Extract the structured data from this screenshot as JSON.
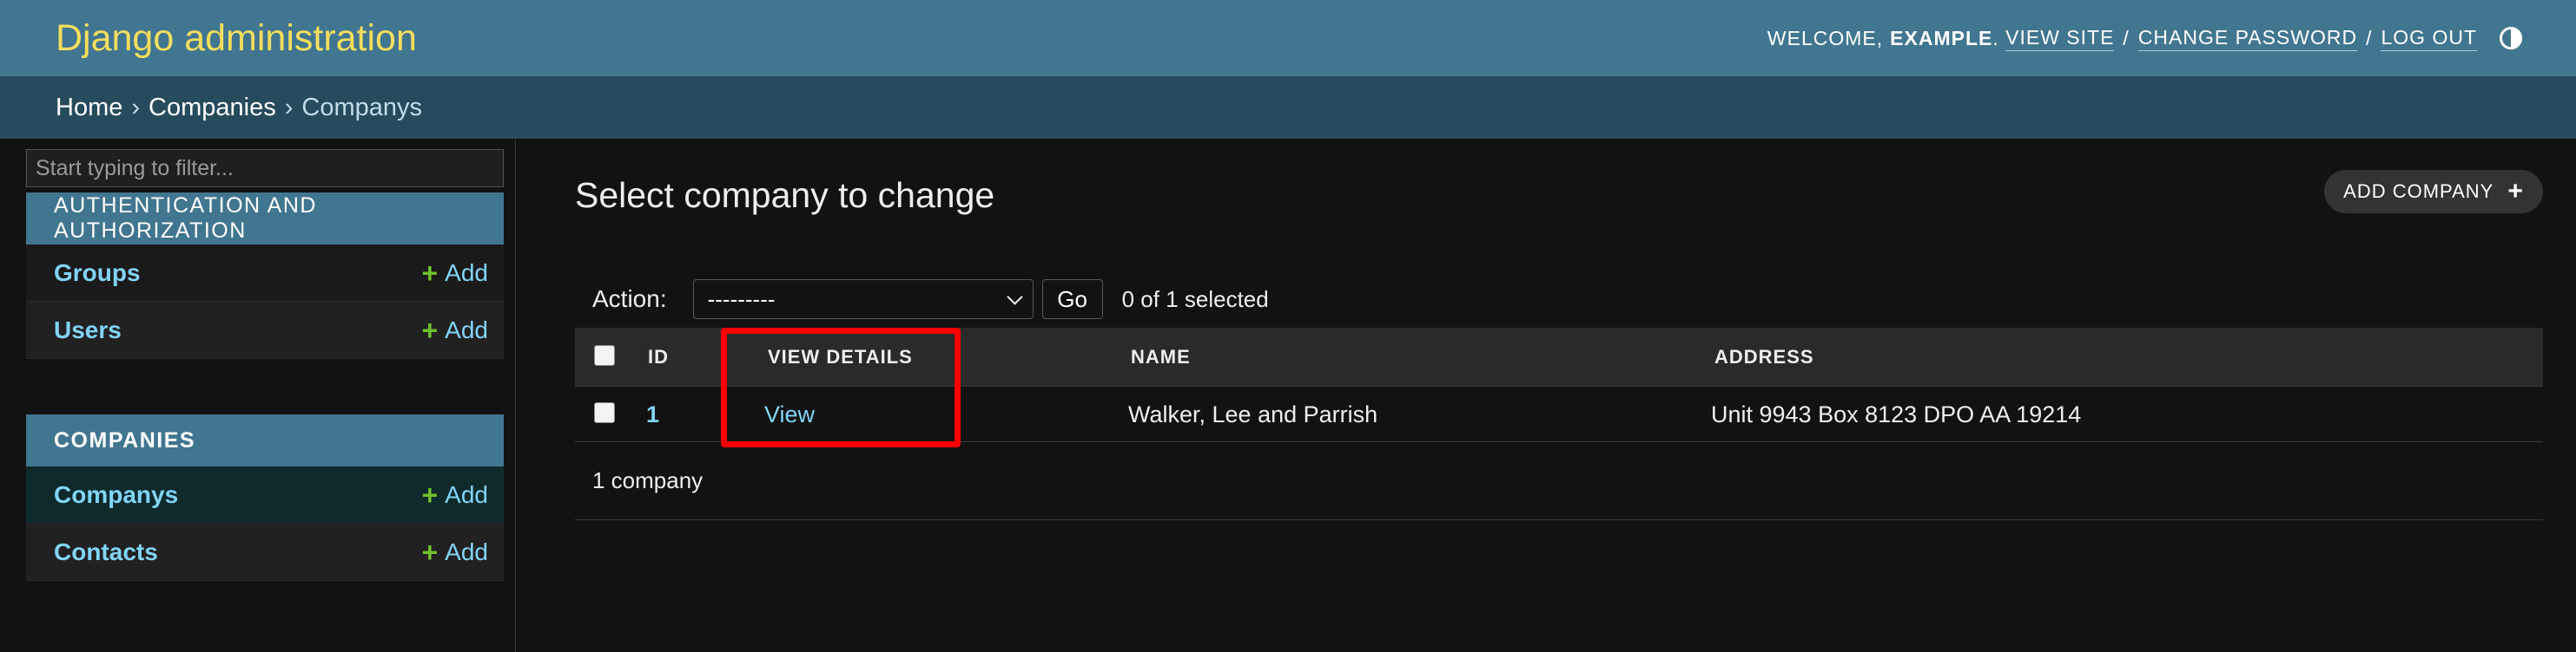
{
  "header": {
    "brand": "Django administration",
    "welcome_prefix": "Welcome,",
    "username": "Example",
    "view_site": "View site",
    "change_password": "Change password",
    "log_out": "Log out",
    "separator": "/"
  },
  "breadcrumbs": {
    "home": "Home",
    "app": "Companies",
    "current": "Companys",
    "arrow": "›"
  },
  "sidebar": {
    "filter_placeholder": "Start typing to filter...",
    "modules": [
      {
        "caption": "Authentication and Authorization",
        "models": [
          {
            "name": "Groups",
            "add_label": "Add"
          },
          {
            "name": "Users",
            "add_label": "Add"
          }
        ]
      },
      {
        "caption": "Companies",
        "models": [
          {
            "name": "Companys",
            "add_label": "Add",
            "current": true
          },
          {
            "name": "Contacts",
            "add_label": "Add"
          }
        ]
      }
    ]
  },
  "main": {
    "title": "Select company to change",
    "add_button_label": "Add company",
    "actions": {
      "label": "Action:",
      "selected_option": "---------",
      "go_label": "Go",
      "selection_count": "0 of 1 selected"
    },
    "table": {
      "columns": [
        "ID",
        "View details",
        "Name",
        "Address"
      ],
      "rows": [
        {
          "id": "1",
          "view_details": "View",
          "name": "Walker, Lee and Parrish",
          "address": "Unit 9943 Box 8123 DPO AA 19214"
        }
      ]
    },
    "result_count": "1 company"
  },
  "colors": {
    "header_bg": "#417690",
    "brand_yellow": "#f5dd5d",
    "breadcrumb_bg": "#264b5d",
    "link_blue": "#81d4fa",
    "add_green": "#70bf2b",
    "highlight_red": "#ff0000",
    "page_bg": "#121212"
  },
  "icons": {
    "theme_toggle": "half-circle-contrast-icon",
    "add": "plus-icon",
    "select": "chevron-down-icon"
  }
}
